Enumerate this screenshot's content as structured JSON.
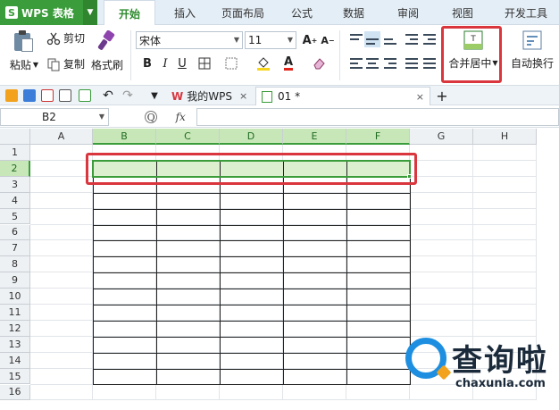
{
  "app": {
    "title": "WPS 表格",
    "logo_letter": "S"
  },
  "ribbon_tabs": [
    "开始",
    "插入",
    "页面布局",
    "公式",
    "数据",
    "审阅",
    "视图",
    "开发工具"
  ],
  "active_tab": "开始",
  "toolbar": {
    "paste": "粘贴",
    "cut": "剪切",
    "copy": "复制",
    "format_painter": "格式刷",
    "font_name": "宋体",
    "font_size": "11",
    "bold": "B",
    "italic": "I",
    "underline": "U",
    "merge_center": "合并居中",
    "wrap_text": "自动换行"
  },
  "doc_tabs": [
    {
      "label": "我的WPS",
      "close": "×"
    },
    {
      "label": "01 *",
      "close": "×"
    }
  ],
  "new_tab": "+",
  "formula_bar": {
    "cell_ref": "B2",
    "fx": "fx",
    "zoom_icon": "Q",
    "value": ""
  },
  "sheet": {
    "columns": [
      "A",
      "B",
      "C",
      "D",
      "E",
      "F",
      "G",
      "H"
    ],
    "rows": [
      "1",
      "2",
      "3",
      "4",
      "5",
      "6",
      "7",
      "8",
      "9",
      "10",
      "11",
      "12",
      "13",
      "14",
      "15",
      "16"
    ],
    "selected_range": "B2:F2"
  },
  "watermark": {
    "title": "查询啦",
    "url": "chaxunla.com"
  },
  "colors": {
    "accent": "#3a9c3a",
    "highlight": "#d9363e",
    "selection": "#dcf0d0"
  }
}
